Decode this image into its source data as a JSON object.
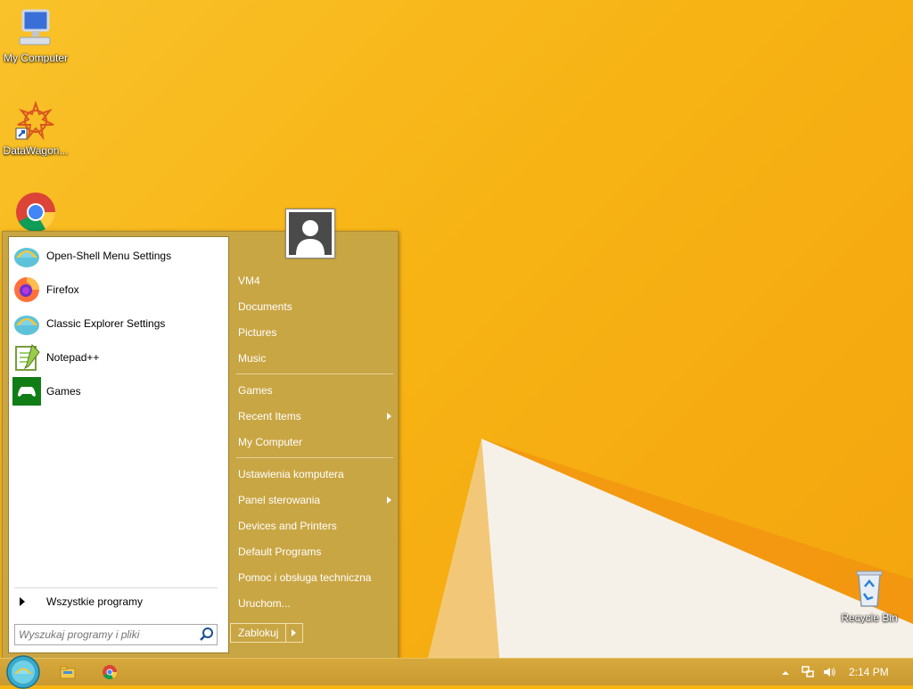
{
  "desktop": {
    "icons": [
      {
        "label": "My Computer",
        "icon": "computer-icon"
      },
      {
        "label": "DataWagon...",
        "icon": "datawagon-icon"
      },
      {
        "label": "",
        "icon": "chrome-icon"
      },
      {
        "label": "Recycle Bin",
        "icon": "recycle-bin-icon"
      }
    ]
  },
  "start_menu": {
    "programs": [
      {
        "label": "Open-Shell Menu Settings",
        "icon": "open-shell-icon"
      },
      {
        "label": "Firefox",
        "icon": "firefox-icon"
      },
      {
        "label": "Classic Explorer Settings",
        "icon": "open-shell-icon"
      },
      {
        "label": "Notepad++",
        "icon": "notepad-plus-plus-icon"
      },
      {
        "label": "Games",
        "icon": "games-controller-icon"
      }
    ],
    "all_programs": "Wszystkie programy",
    "search_placeholder": "Wyszukaj programy i pliki",
    "right": {
      "user": "VM4",
      "documents": "Documents",
      "pictures": "Pictures",
      "music": "Music",
      "games": "Games",
      "recent_items": "Recent Items",
      "my_computer": "My Computer",
      "ustawienia": "Ustawienia komputera",
      "panel": "Panel sterowania",
      "devices": "Devices and Printers",
      "default_programs": "Default Programs",
      "help": "Pomoc i obsługa techniczna",
      "run": "Uruchom..."
    },
    "lock": "Zablokuj"
  },
  "taskbar": {
    "clock": "2:14 PM",
    "pinned": [
      "file-explorer-icon",
      "chrome-icon"
    ],
    "tray": [
      "show-hidden-icons-icon",
      "network-icon",
      "volume-icon"
    ]
  },
  "colors": {
    "wallpaper": "#f7b314",
    "menu_background": "#c9a644",
    "taskbar": "#cf9f35"
  }
}
